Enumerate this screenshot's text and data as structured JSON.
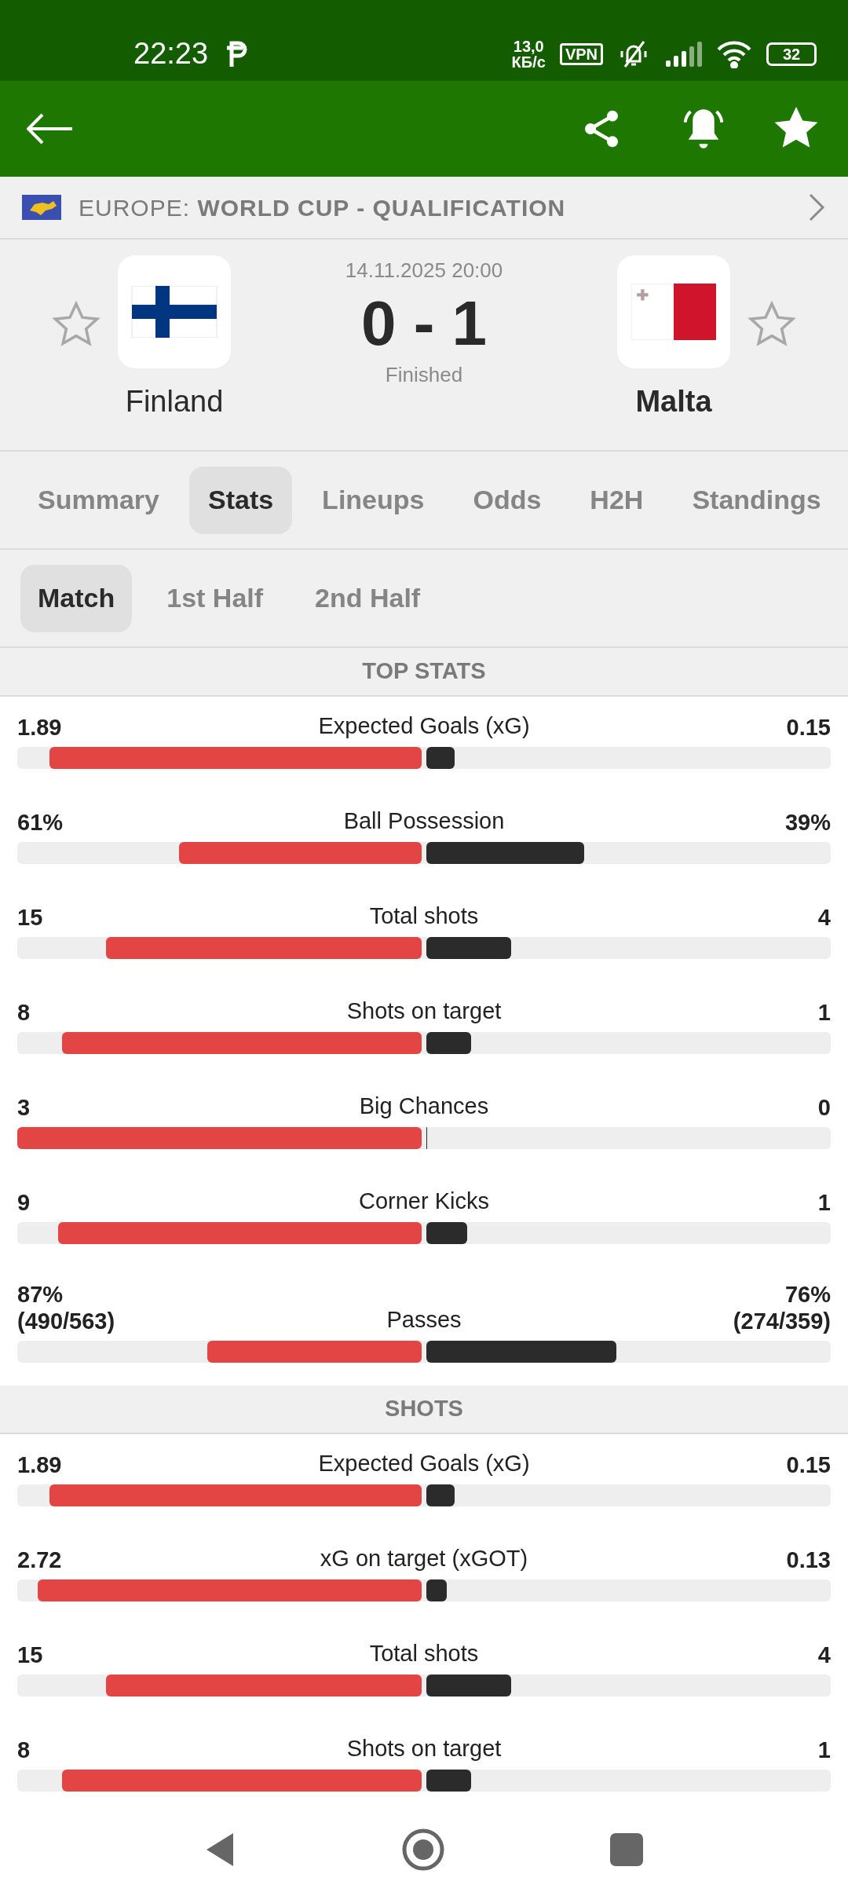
{
  "status_bar": {
    "time": "22:23",
    "network_speed": [
      "13,0",
      "КБ/с"
    ],
    "vpn": "VPN",
    "battery": "32"
  },
  "league": {
    "region": "EUROPE:",
    "name": "WORLD CUP - QUALIFICATION"
  },
  "match": {
    "date": "14.11.2025 20:00",
    "score": "0 - 1",
    "status": "Finished",
    "home": {
      "name": "Finland",
      "winner": false,
      "favorite": false
    },
    "away": {
      "name": "Malta",
      "winner": true,
      "favorite": false
    }
  },
  "tabs": [
    {
      "label": "Summary",
      "selected": false
    },
    {
      "label": "Stats",
      "selected": true
    },
    {
      "label": "Lineups",
      "selected": false
    },
    {
      "label": "Odds",
      "selected": false
    },
    {
      "label": "H2H",
      "selected": false
    },
    {
      "label": "Standings",
      "selected": false
    }
  ],
  "period_tabs": [
    {
      "label": "Match",
      "selected": true
    },
    {
      "label": "1st Half",
      "selected": false
    },
    {
      "label": "2nd Half",
      "selected": false
    }
  ],
  "sections": [
    {
      "title": "TOP STATS",
      "stats": [
        {
          "label": "Expected Goals (xG)",
          "home": {
            "value": "1.89",
            "level": 0.92
          },
          "away": {
            "value": "0.15",
            "level": 0.07
          }
        },
        {
          "label": "Ball Possession",
          "home": {
            "value": "61%",
            "level": 0.6
          },
          "away": {
            "value": "39%",
            "level": 0.39
          }
        },
        {
          "label": "Total shots",
          "home": {
            "value": "15",
            "level": 0.78
          },
          "away": {
            "value": "4",
            "level": 0.21
          }
        },
        {
          "label": "Shots on target",
          "home": {
            "value": "8",
            "level": 0.89
          },
          "away": {
            "value": "1",
            "level": 0.11
          }
        },
        {
          "label": "Big Chances",
          "home": {
            "value": "3",
            "level": 1
          },
          "away": {
            "value": "0",
            "level": 0
          }
        },
        {
          "label": "Corner Kicks",
          "home": {
            "value": "9",
            "level": 0.9
          },
          "away": {
            "value": "1",
            "level": 0.1
          }
        },
        {
          "label": "Passes",
          "home": {
            "value": "87%",
            "detail": "(490/563)",
            "level": 0.53
          },
          "away": {
            "value": "76%",
            "detail": "(274/359)",
            "level": 0.47
          }
        }
      ]
    },
    {
      "title": "SHOTS",
      "stats": [
        {
          "label": "Expected Goals (xG)",
          "home": {
            "value": "1.89",
            "level": 0.92
          },
          "away": {
            "value": "0.15",
            "level": 0.07
          }
        },
        {
          "label": "xG on target (xGOT)",
          "home": {
            "value": "2.72",
            "level": 0.95
          },
          "away": {
            "value": "0.13",
            "level": 0.05
          }
        },
        {
          "label": "Total shots",
          "home": {
            "value": "15",
            "level": 0.78
          },
          "away": {
            "value": "4",
            "level": 0.21
          }
        },
        {
          "label": "Shots on target",
          "home": {
            "value": "8",
            "level": 0.89
          },
          "away": {
            "value": "1",
            "level": 0.11
          }
        }
      ]
    }
  ]
}
